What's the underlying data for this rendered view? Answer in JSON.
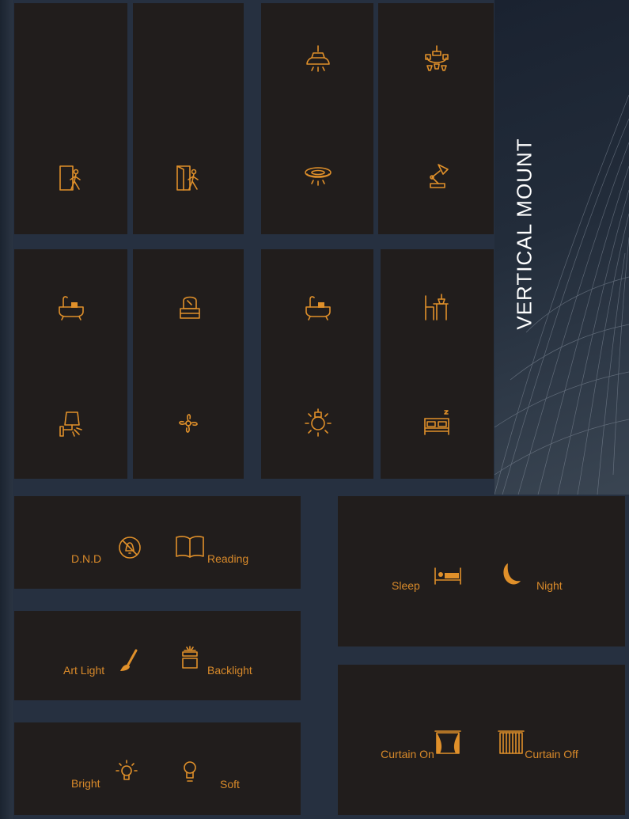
{
  "side_label": "VERTICAL MOUNT",
  "colors": {
    "panel": "#211d1c",
    "accent": "#e0902a",
    "background": "#263040"
  },
  "vertical_panels": [
    {
      "icons": [
        "person-exit-door-icon",
        "bathtub-icon",
        "wall-lamp-icon"
      ]
    },
    {
      "icons": [
        "person-open-door-icon",
        "vanity-mirror-icon",
        "ceiling-fan-icon"
      ]
    },
    {
      "icons": [
        "pendant-lamp-icon",
        "ceiling-light-icon",
        "bathtub-icon",
        "light-bulb-icon"
      ]
    },
    {
      "icons": [
        "chandelier-icon",
        "desk-lamp-icon",
        "desk-chair-icon",
        "bed-icon"
      ]
    }
  ],
  "scene_panels": {
    "dnd": "D.N.D",
    "reading": "Reading",
    "art_light": "Art Light",
    "backlight": "Backlight",
    "bright": "Bright",
    "soft": "Soft",
    "sleep": "Sleep",
    "night": "Night",
    "curtain_on": "Curtain On",
    "curtain_off": "Curtain Off"
  }
}
